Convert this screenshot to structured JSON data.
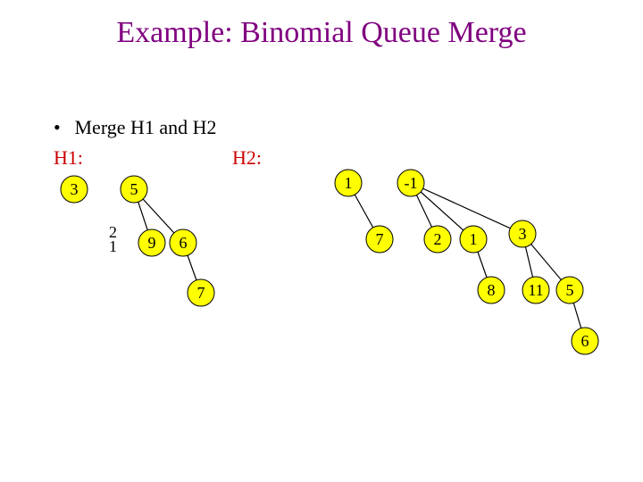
{
  "title": "Example: Binomial Queue Merge",
  "bullet": "Merge H1 and H2",
  "h1label": "H1:",
  "h2label": "H2:",
  "stray_top": "2",
  "stray_bot": "1",
  "h1": {
    "n3": "3",
    "n5": "5",
    "n9": "9",
    "n6": "6",
    "n7": "7"
  },
  "h2": {
    "n1a": "1",
    "n7a": "7",
    "nm1": "-1",
    "n2": "2",
    "n1b": "1",
    "n3b": "3",
    "n8": "8",
    "n11": "11",
    "n5b": "5",
    "n6b": "6"
  }
}
